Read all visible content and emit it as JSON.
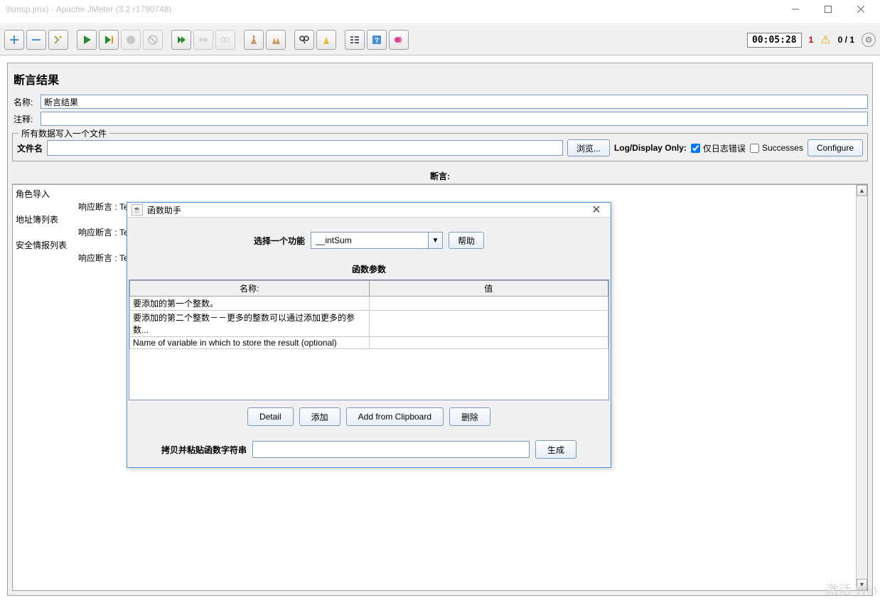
{
  "window": {
    "title": "\\lsmsp.jmx) - Apache JMeter (3.2 r1790748)"
  },
  "toolbar": {
    "time": "00:05:28",
    "errors": "1",
    "progress": "0 / 1"
  },
  "panel": {
    "title": "断言结果",
    "name_label": "名称:",
    "name_value": "断言结果",
    "comment_label": "注释:",
    "comment_value": "",
    "fieldset_legend": "所有数据写入一个文件",
    "file_label": "文件名",
    "file_value": "",
    "browse_btn": "浏览...",
    "logdisplay_label": "Log/Display Only:",
    "only_errors_label": "仅日志错误",
    "successes_label": "Successes",
    "configure_btn": "Configure",
    "assert_head": "断言:"
  },
  "assert_lines": [
    {
      "cls": "l0",
      "txt": "角色导入"
    },
    {
      "cls": "l1",
      "txt": "响应断言 : Test failed: text expected not to contain /不正确/"
    },
    {
      "cls": "l0",
      "txt": "地址簿列表"
    },
    {
      "cls": "l1",
      "txt": "响应断言 : Tes"
    },
    {
      "cls": "l0",
      "txt": "安全情报列表"
    },
    {
      "cls": "l1",
      "txt": "响应断言 : Tes"
    }
  ],
  "dialog": {
    "title": "函数助手",
    "select_label": "选择一个功能",
    "selected_func": "__intSum",
    "help_btn": "帮助",
    "params_head": "函数参数",
    "col_name": "名称:",
    "col_value": "值",
    "rows": [
      {
        "name": "要添加的第一个整数。",
        "value": ""
      },
      {
        "name": "要添加的第二个整数－－更多的整数可以通过添加更多的参数...",
        "value": ""
      },
      {
        "name": "Name of variable in which to store the result (optional)",
        "value": ""
      }
    ],
    "btn_detail": "Detail",
    "btn_add": "添加",
    "btn_clip": "Add from Clipboard",
    "btn_del": "删除",
    "gen_label": "拷贝并粘贴函数字符串",
    "gen_value": "",
    "gen_btn": "生成"
  },
  "watermark": "激活 Win"
}
